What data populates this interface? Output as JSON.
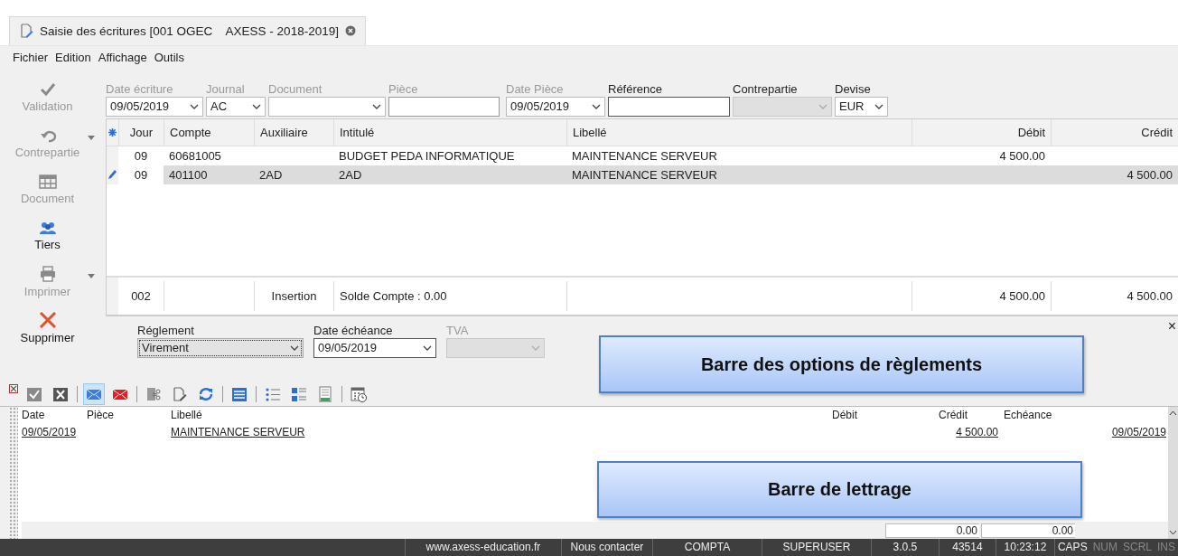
{
  "tab": {
    "title": "Saisie des écritures [001 OGEC    AXESS - 2018-2019]",
    "selected": true
  },
  "menu": [
    "Fichier",
    "Edition",
    "Affichage",
    "Outils"
  ],
  "sidebar": [
    {
      "kind": "validate",
      "label": "Validation",
      "disabled": true,
      "has_menu": false
    },
    {
      "kind": "undo",
      "label": "Contrepartie",
      "disabled": true,
      "has_menu": true
    },
    {
      "kind": "table",
      "label": "Document",
      "disabled": true,
      "has_menu": false
    },
    {
      "kind": "people",
      "label": "Tiers",
      "disabled": false,
      "has_menu": false
    },
    {
      "kind": "print",
      "label": "Imprimer",
      "disabled": true,
      "has_menu": true
    },
    {
      "kind": "delete",
      "label": "Supprimer",
      "disabled": false,
      "has_menu": false
    }
  ],
  "entry_fields": [
    {
      "label": "Date écriture",
      "kind": "combo",
      "value": "09/05/2019",
      "label_dimmed": true,
      "disabled": false
    },
    {
      "label": "Journal",
      "kind": "combo",
      "value": "AC",
      "label_dimmed": true,
      "disabled": false
    },
    {
      "label": "Document",
      "kind": "combo",
      "label_dimmed": true,
      "disabled": false
    },
    {
      "label": "Pièce",
      "kind": "text",
      "label_dimmed": true,
      "disabled": false
    },
    {
      "label": "Date Pièce",
      "kind": "combo",
      "value": "09/05/2019",
      "label_dimmed": true,
      "disabled": false
    },
    {
      "label": "Référence",
      "kind": "text",
      "label_dimmed": false,
      "disabled": false
    },
    {
      "label": "Contrepartie",
      "kind": "combo",
      "label_dimmed": false,
      "disabled": true
    },
    {
      "label": "Devise",
      "kind": "combo",
      "value": "EUR",
      "label_dimmed": false,
      "disabled": false
    }
  ],
  "grid": {
    "columns": [
      {
        "label": "Jour",
        "kind": "day"
      },
      {
        "label": "Compte",
        "kind": "text"
      },
      {
        "label": "Auxiliaire",
        "kind": "text"
      },
      {
        "label": "Intitulé",
        "kind": "text"
      },
      {
        "label": "Libellé",
        "kind": "text"
      },
      {
        "label": "Débit",
        "kind": "amount"
      },
      {
        "label": "Crédit",
        "kind": "amount"
      }
    ],
    "rows": [
      {
        "kind": "entry",
        "cells": [
          "09",
          "60681005",
          null,
          "BUDGET PEDA  INFORMATIQUE",
          "MAINTENANCE SERVEUR",
          "4 500.00",
          null
        ],
        "selected": false,
        "editing": false
      },
      {
        "kind": "entry",
        "cells": [
          "09",
          "401100",
          "2AD",
          "2AD",
          "MAINTENANCE SERVEUR",
          null,
          "4 500.00"
        ],
        "selected": true,
        "editing": true
      },
      {
        "kind": "total",
        "cells": [
          "002",
          null,
          "Insertion",
          "Solde Compte : 0.00",
          null,
          "4 500.00",
          "4 500.00"
        ]
      }
    ]
  },
  "payment_fields": [
    {
      "label": "Réglement",
      "kind": "combo",
      "value": "Virement",
      "label_dimmed": false,
      "disabled": false,
      "focused": true
    },
    {
      "label": "Date échéance",
      "kind": "combo",
      "value": "09/05/2019",
      "label_dimmed": false,
      "disabled": false,
      "focused": false
    },
    {
      "label": "TVA",
      "kind": "combo",
      "label_dimmed": true,
      "disabled": true,
      "focused": false
    }
  ],
  "panel_close": "×",
  "toolbar": [
    {
      "kind": "check",
      "selected": false
    },
    {
      "kind": "cross",
      "selected": false
    },
    {
      "kind": "separator"
    },
    {
      "kind": "mail",
      "selected": true
    },
    {
      "kind": "mail-red",
      "selected": false
    },
    {
      "kind": "separator"
    },
    {
      "kind": "cut-doc",
      "selected": false
    },
    {
      "kind": "edit-doc",
      "selected": false
    },
    {
      "kind": "refresh",
      "selected": false
    },
    {
      "kind": "separator"
    },
    {
      "kind": "list-block",
      "selected": false
    },
    {
      "kind": "separator"
    },
    {
      "kind": "bullets",
      "selected": false
    },
    {
      "kind": "detail-list",
      "selected": false
    },
    {
      "kind": "page",
      "selected": false
    },
    {
      "kind": "separator"
    },
    {
      "kind": "calendar",
      "selected": false
    }
  ],
  "lettrage": {
    "columns": [
      {
        "label": "Date",
        "kind": "text"
      },
      {
        "label": "Pièce",
        "kind": "text"
      },
      {
        "label": "Libellé",
        "kind": "text"
      },
      {
        "label": "Débit",
        "kind": "amount"
      },
      {
        "label": "Crédit",
        "kind": "amount"
      },
      {
        "label": "Echéance",
        "kind": "date"
      }
    ],
    "rows": [
      [
        "09/05/2019",
        null,
        "MAINTENANCE SERVEUR",
        null,
        "4 500.00",
        "09/05/2019"
      ]
    ],
    "totals": [
      "0.00",
      "0.00"
    ]
  },
  "callouts": [
    "Barre des options de règlements",
    "Barre de lettrage"
  ],
  "status_bar": [
    {
      "text": "www.axess-education.fr",
      "dimmed": false
    },
    {
      "text": "Nous contacter",
      "dimmed": false
    },
    {
      "text": "COMPTA",
      "dimmed": false
    },
    {
      "text": "SUPERUSER",
      "dimmed": false
    },
    {
      "text": "3.0.5",
      "dimmed": false
    },
    {
      "text": "43514",
      "dimmed": false
    },
    {
      "text": "10:23:12",
      "dimmed": false
    },
    {
      "text": "CAPS",
      "dimmed": false
    },
    {
      "text": "NUM",
      "dimmed": true
    },
    {
      "text": "SCRL",
      "dimmed": true
    },
    {
      "text": "INS",
      "dimmed": true
    }
  ]
}
